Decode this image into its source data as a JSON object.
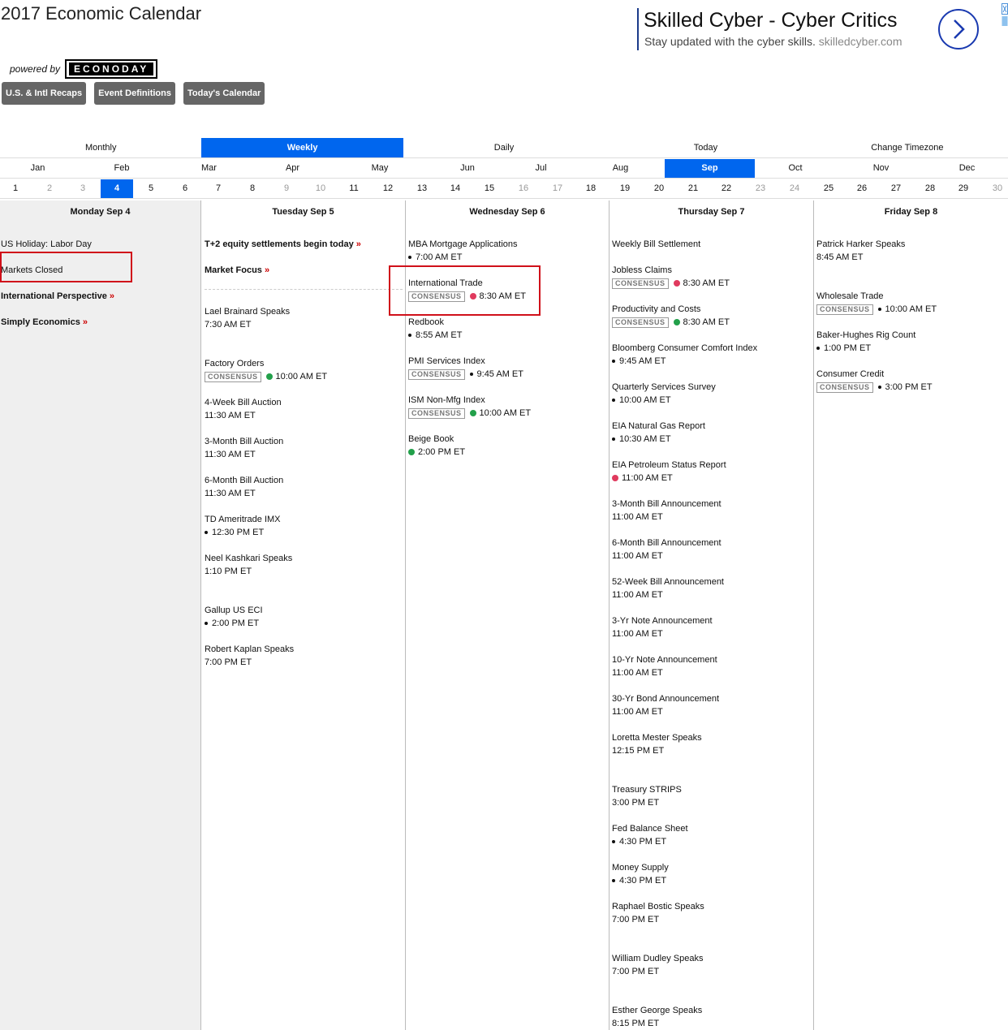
{
  "header": {
    "title": "2017 Economic Calendar",
    "powered_by": "powered by",
    "logo_text": "ECONODAY"
  },
  "nav_buttons": [
    "U.S. & Intl Recaps",
    "Event Definitions",
    "Today's Calendar"
  ],
  "ad": {
    "title": "Skilled Cyber - Cyber Critics",
    "subtitle": "Stay updated with the cyber skills.",
    "url": "skilledcyber.com"
  },
  "views": {
    "monthly": "Monthly",
    "weekly": "Weekly",
    "daily": "Daily",
    "today": "Today",
    "change_timezone": "Change Timezone",
    "active": "Weekly"
  },
  "months": [
    "Jan",
    "Feb",
    "Mar",
    "Apr",
    "May",
    "Jun",
    "Jul",
    "Aug",
    "Sep",
    "Oct",
    "Nov",
    "Dec"
  ],
  "active_month": "Sep",
  "days": [
    "1",
    "2",
    "3",
    "4",
    "5",
    "6",
    "7",
    "8",
    "9",
    "10",
    "11",
    "12",
    "13",
    "14",
    "15",
    "16",
    "17",
    "18",
    "19",
    "20",
    "21",
    "22",
    "23",
    "24",
    "25",
    "26",
    "27",
    "28",
    "29",
    "30"
  ],
  "active_day": "4",
  "weekend_days": [
    "2",
    "3",
    "9",
    "10",
    "16",
    "17",
    "23",
    "24",
    "30"
  ],
  "colors": {
    "accent": "#0066ee",
    "dot_red": "#e03a5e",
    "dot_green": "#22a04a",
    "highlight": "#d0101a"
  },
  "week": {
    "monday": {
      "head": "Monday Sep 4",
      "events": [
        {
          "name": "US Holiday: Labor Day"
        },
        {
          "name": "Markets Closed"
        },
        {
          "name": "International Perspective",
          "link": "»"
        },
        {
          "name": "Simply Economics",
          "link": "»"
        }
      ]
    },
    "tuesday": {
      "head": "Tuesday Sep 5",
      "events": [
        {
          "name": "T+2 equity settlements begin today",
          "link": "»"
        },
        {
          "name": "Market Focus",
          "link": "»"
        },
        {
          "name": "Lael Brainard Speaks",
          "time": "7:30 AM ET"
        },
        {
          "name": "Factory Orders",
          "consensus": "CONSENSUS",
          "time": "10:00 AM ET"
        },
        {
          "name": "4-Week Bill Auction",
          "time": "11:30 AM ET"
        },
        {
          "name": "3-Month Bill Auction",
          "time": "11:30 AM ET"
        },
        {
          "name": "6-Month Bill Auction",
          "time": "11:30 AM ET"
        },
        {
          "name": "TD Ameritrade IMX",
          "time": "12:30 PM ET"
        },
        {
          "name": "Neel Kashkari Speaks",
          "time": "1:10 PM ET"
        },
        {
          "name": "Gallup US ECI",
          "time": "2:00 PM ET"
        },
        {
          "name": "Robert Kaplan Speaks",
          "time": "7:00 PM ET"
        }
      ]
    },
    "wednesday": {
      "head": "Wednesday Sep 6",
      "events": [
        {
          "name": "MBA Mortgage Applications",
          "time": "7:00 AM ET"
        },
        {
          "name": "International Trade",
          "consensus": "CONSENSUS",
          "time": "8:30 AM ET"
        },
        {
          "name": "Redbook",
          "time": "8:55 AM ET"
        },
        {
          "name": "PMI Services Index",
          "consensus": "CONSENSUS",
          "time": "9:45 AM ET"
        },
        {
          "name": "ISM Non-Mfg Index",
          "consensus": "CONSENSUS",
          "time": "10:00 AM ET"
        },
        {
          "name": "Beige Book",
          "time": "2:00 PM ET"
        }
      ]
    },
    "thursday": {
      "head": "Thursday Sep 7",
      "events": [
        {
          "name": "Weekly Bill Settlement"
        },
        {
          "name": "Jobless Claims",
          "consensus": "CONSENSUS",
          "time": "8:30 AM ET"
        },
        {
          "name": "Productivity and Costs",
          "consensus": "CONSENSUS",
          "time": "8:30 AM ET"
        },
        {
          "name": "Bloomberg Consumer Comfort Index",
          "time": "9:45 AM ET"
        },
        {
          "name": "Quarterly Services Survey",
          "time": "10:00 AM ET"
        },
        {
          "name": "EIA Natural Gas Report",
          "time": "10:30 AM ET"
        },
        {
          "name": "EIA Petroleum Status Report",
          "time": "11:00 AM ET"
        },
        {
          "name": "3-Month Bill Announcement",
          "time": "11:00 AM ET"
        },
        {
          "name": "6-Month Bill Announcement",
          "time": "11:00 AM ET"
        },
        {
          "name": "52-Week Bill Announcement",
          "time": "11:00 AM ET"
        },
        {
          "name": "3-Yr Note Announcement",
          "time": "11:00 AM ET"
        },
        {
          "name": "10-Yr Note Announcement",
          "time": "11:00 AM ET"
        },
        {
          "name": "30-Yr Bond Announcement",
          "time": "11:00 AM ET"
        },
        {
          "name": "Loretta Mester Speaks",
          "time": "12:15 PM ET"
        },
        {
          "name": "Treasury STRIPS",
          "time": "3:00 PM ET"
        },
        {
          "name": "Fed Balance Sheet",
          "time": "4:30 PM ET"
        },
        {
          "name": "Money Supply",
          "time": "4:30 PM ET"
        },
        {
          "name": "Raphael Bostic Speaks",
          "time": "7:00 PM ET"
        },
        {
          "name": "William Dudley Speaks",
          "time": "7:00 PM ET"
        },
        {
          "name": "Esther George Speaks",
          "time": "8:15 PM ET"
        }
      ]
    },
    "friday": {
      "head": "Friday Sep 8",
      "events": [
        {
          "name": "Patrick Harker Speaks",
          "time": "8:45 AM ET"
        },
        {
          "name": "Wholesale Trade",
          "consensus": "CONSENSUS",
          "time": "10:00 AM ET"
        },
        {
          "name": "Baker-Hughes Rig Count",
          "time": "1:00 PM ET"
        },
        {
          "name": "Consumer Credit",
          "consensus": "CONSENSUS",
          "time": "3:00 PM ET"
        }
      ]
    }
  }
}
